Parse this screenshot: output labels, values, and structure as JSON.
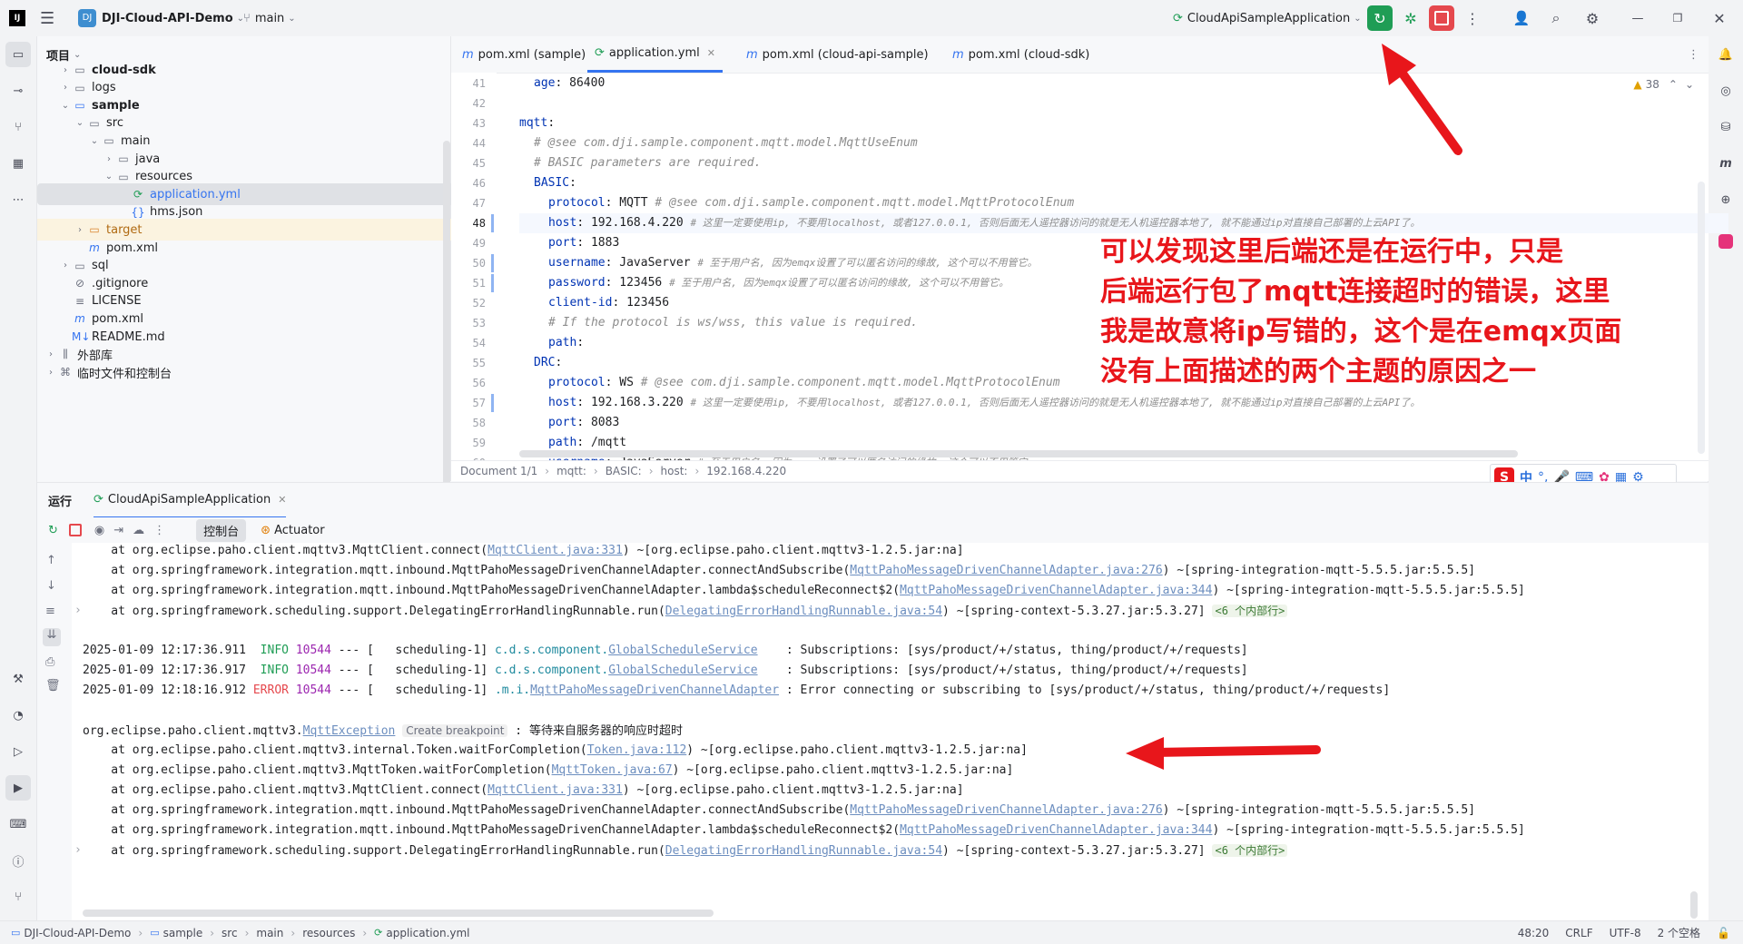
{
  "titlebar": {
    "logo": "IJ",
    "project_badge": "DJ",
    "project_name": "DJI-Cloud-API-Demo",
    "branch": "main",
    "run_config": "CloudApiSampleApplication"
  },
  "project_panel": {
    "title": "项目",
    "items": [
      {
        "label": "cloud-sdk",
        "indent": 1,
        "type": "folder",
        "arrow": ">",
        "bold": true
      },
      {
        "label": "logs",
        "indent": 1,
        "type": "folder",
        "arrow": ">",
        "bold": false
      },
      {
        "label": "sample",
        "indent": 1,
        "type": "module",
        "arrow": "v",
        "bold": true
      },
      {
        "label": "src",
        "indent": 2,
        "type": "folder",
        "arrow": "v",
        "bold": false
      },
      {
        "label": "main",
        "indent": 3,
        "type": "folder",
        "arrow": "v",
        "bold": false
      },
      {
        "label": "java",
        "indent": 4,
        "type": "folder",
        "arrow": ">",
        "bold": false
      },
      {
        "label": "resources",
        "indent": 4,
        "type": "folder",
        "arrow": "v",
        "bold": false
      },
      {
        "label": "application.yml",
        "indent": 5,
        "type": "yml",
        "arrow": "",
        "bold": false,
        "selected": true
      },
      {
        "label": "hms.json",
        "indent": 5,
        "type": "json",
        "arrow": "",
        "bold": false
      },
      {
        "label": "target",
        "indent": 2,
        "type": "folder-orange",
        "arrow": ">",
        "bold": false,
        "highlight": true
      },
      {
        "label": "pom.xml",
        "indent": 2,
        "type": "maven",
        "arrow": "",
        "bold": false
      },
      {
        "label": "sql",
        "indent": 1,
        "type": "folder",
        "arrow": ">",
        "bold": false
      },
      {
        "label": ".gitignore",
        "indent": 1,
        "type": "ignore",
        "arrow": "",
        "bold": false
      },
      {
        "label": "LICENSE",
        "indent": 1,
        "type": "text",
        "arrow": "",
        "bold": false
      },
      {
        "label": "pom.xml",
        "indent": 1,
        "type": "maven",
        "arrow": "",
        "bold": false
      },
      {
        "label": "README.md",
        "indent": 1,
        "type": "md",
        "arrow": "",
        "bold": false
      },
      {
        "label": "外部库",
        "indent": 0,
        "type": "lib",
        "arrow": ">",
        "bold": false
      },
      {
        "label": "临时文件和控制台",
        "indent": 0,
        "type": "scratch",
        "arrow": ">",
        "bold": false
      }
    ]
  },
  "tabs": [
    {
      "label": "pom.xml (sample)",
      "icon": "maven",
      "active": false
    },
    {
      "label": "application.yml",
      "icon": "yml",
      "active": true
    },
    {
      "label": "pom.xml (cloud-api-sample)",
      "icon": "maven",
      "active": false
    },
    {
      "label": "pom.xml (cloud-sdk)",
      "icon": "maven",
      "active": false
    }
  ],
  "editor": {
    "warnings": "38",
    "lines": [
      {
        "n": "41",
        "indent": 1,
        "parts": [
          {
            "t": "k",
            "s": "age"
          },
          {
            "t": "v",
            "s": ": 86400"
          }
        ]
      },
      {
        "n": "42",
        "indent": 0,
        "parts": []
      },
      {
        "n": "43",
        "indent": 0,
        "parts": [
          {
            "t": "k",
            "s": "mqtt"
          },
          {
            "t": "v",
            "s": ":"
          }
        ]
      },
      {
        "n": "44",
        "indent": 1,
        "parts": [
          {
            "t": "c",
            "s": "# @see com.dji.sample.component.mqtt.model.MqttUseEnum"
          }
        ]
      },
      {
        "n": "45",
        "indent": 1,
        "parts": [
          {
            "t": "c",
            "s": "# BASIC parameters are required."
          }
        ]
      },
      {
        "n": "46",
        "indent": 1,
        "parts": [
          {
            "t": "k",
            "s": "BASIC"
          },
          {
            "t": "v",
            "s": ":"
          }
        ]
      },
      {
        "n": "47",
        "indent": 2,
        "parts": [
          {
            "t": "k",
            "s": "protocol"
          },
          {
            "t": "v",
            "s": ": MQTT "
          },
          {
            "t": "c",
            "s": "# @see com.dji.sample.component.mqtt.model.MqttProtocolEnum"
          }
        ]
      },
      {
        "n": "48",
        "indent": 2,
        "parts": [
          {
            "t": "k",
            "s": "host"
          },
          {
            "t": "v",
            "s": ": 192.168.4.220 "
          },
          {
            "t": "c",
            "s": "# 这里一定要使用ip, 不要用localhost, 或者127.0.0.1, 否则后面无人遥控器访问的就是无人机遥控器本地了, 就不能通过ip对直接自己部署的上云API了。"
          }
        ]
      },
      {
        "n": "49",
        "indent": 2,
        "parts": [
          {
            "t": "k",
            "s": "port"
          },
          {
            "t": "v",
            "s": ": 1883"
          }
        ]
      },
      {
        "n": "50",
        "indent": 2,
        "parts": [
          {
            "t": "k",
            "s": "username"
          },
          {
            "t": "v",
            "s": ": JavaServer "
          },
          {
            "t": "c",
            "s": "# 至于用户名, 因为emqx设置了可以匿名访问的缘故, 这个可以不用管它。"
          }
        ]
      },
      {
        "n": "51",
        "indent": 2,
        "parts": [
          {
            "t": "k",
            "s": "password"
          },
          {
            "t": "v",
            "s": ": 123456 "
          },
          {
            "t": "c",
            "s": "# 至于用户名, 因为emqx设置了可以匿名访问的缘故, 这个可以不用管它。"
          }
        ]
      },
      {
        "n": "52",
        "indent": 2,
        "parts": [
          {
            "t": "k",
            "s": "client-id"
          },
          {
            "t": "v",
            "s": ": 123456"
          }
        ]
      },
      {
        "n": "53",
        "indent": 2,
        "parts": [
          {
            "t": "c",
            "s": "# If the protocol is ws/wss, this value is required."
          }
        ]
      },
      {
        "n": "54",
        "indent": 2,
        "parts": [
          {
            "t": "k",
            "s": "path"
          },
          {
            "t": "v",
            "s": ":"
          }
        ]
      },
      {
        "n": "55",
        "indent": 1,
        "parts": [
          {
            "t": "k",
            "s": "DRC"
          },
          {
            "t": "v",
            "s": ":"
          }
        ]
      },
      {
        "n": "56",
        "indent": 2,
        "parts": [
          {
            "t": "k",
            "s": "protocol"
          },
          {
            "t": "v",
            "s": ": WS "
          },
          {
            "t": "c",
            "s": "# @see com.dji.sample.component.mqtt.model.MqttProtocolEnum"
          }
        ]
      },
      {
        "n": "57",
        "indent": 2,
        "parts": [
          {
            "t": "k",
            "s": "host"
          },
          {
            "t": "v",
            "s": ": 192.168.3.220 "
          },
          {
            "t": "c",
            "s": "# 这里一定要使用ip, 不要用localhost, 或者127.0.0.1, 否则后面无人遥控器访问的就是无人机遥控器本地了, 就不能通过ip对直接自己部署的上云API了。"
          }
        ]
      },
      {
        "n": "58",
        "indent": 2,
        "parts": [
          {
            "t": "k",
            "s": "port"
          },
          {
            "t": "v",
            "s": ": 8083"
          }
        ]
      },
      {
        "n": "59",
        "indent": 2,
        "parts": [
          {
            "t": "k",
            "s": "path"
          },
          {
            "t": "v",
            "s": ": /mqtt"
          }
        ]
      },
      {
        "n": "60",
        "indent": 2,
        "parts": [
          {
            "t": "k",
            "s": "username"
          },
          {
            "t": "v",
            "s": ": JavaServer "
          },
          {
            "t": "c",
            "s": "# 至于用户名, 因为emqx设置了可以匿名访问的缘故, 这个可以不用管它。"
          }
        ]
      }
    ],
    "breadcrumb": [
      "Document 1/1",
      "mqtt:",
      "BASIC:",
      "host:",
      "192.168.4.220"
    ]
  },
  "annotation": {
    "lines": [
      "可以发现这里后端还是在运行中，只是",
      "后端运行包了mqtt连接超时的错误，这里",
      "我是故意将ip写错的，这个是在emqx页面",
      "没有上面描述的两个主题的原因之一"
    ]
  },
  "ime": {
    "logo": "S",
    "lang": "中"
  },
  "run_panel": {
    "title": "运行",
    "tab": "CloudApiSampleApplication",
    "subtab_console": "控制台",
    "subtab_actuator": "Actuator"
  },
  "console": {
    "lines": [
      {
        "parts": [
          {
            "t": "p",
            "s": "    at org.eclipse.paho.client.mqttv3.MqttClient.connect("
          },
          {
            "t": "l",
            "s": "MqttClient.java:331"
          },
          {
            "t": "p",
            "s": ") ~[org.eclipse.paho.client.mqttv3-1.2.5.jar:na]"
          }
        ]
      },
      {
        "parts": [
          {
            "t": "p",
            "s": "    at org.springframework.integration.mqtt.inbound.MqttPahoMessageDrivenChannelAdapter.connectAndSubscribe("
          },
          {
            "t": "l",
            "s": "MqttPahoMessageDrivenChannelAdapter.java:276"
          },
          {
            "t": "p",
            "s": ") ~[spring-integration-mqtt-5.5.5.jar:5.5.5]"
          }
        ]
      },
      {
        "parts": [
          {
            "t": "p",
            "s": "    at org.springframework.integration.mqtt.inbound.MqttPahoMessageDrivenChannelAdapter.lambda$scheduleReconnect$2("
          },
          {
            "t": "l",
            "s": "MqttPahoMessageDrivenChannelAdapter.java:344"
          },
          {
            "t": "p",
            "s": ") ~[spring-integration-mqtt-5.5.5.jar:5.5.5]"
          }
        ]
      },
      {
        "parts": [
          {
            "t": "p",
            "s": "    at org.springframework.scheduling.support.DelegatingErrorHandlingRunnable.run("
          },
          {
            "t": "l",
            "s": "DelegatingErrorHandlingRunnable.java:54"
          },
          {
            "t": "p",
            "s": ") ~[spring-context-5.3.27.jar:5.3.27] "
          },
          {
            "t": "h",
            "s": "<6 个内部行>"
          }
        ]
      },
      {
        "parts": []
      },
      {
        "parts": [
          {
            "t": "p",
            "s": "2025-01-09 12:17:36.911  "
          },
          {
            "t": "info",
            "s": "INFO"
          },
          {
            "t": "p",
            "s": " "
          },
          {
            "t": "pid",
            "s": "10544"
          },
          {
            "t": "p",
            "s": " --- [   scheduling-1] "
          },
          {
            "t": "cls",
            "s": "c.d.s.component."
          },
          {
            "t": "l",
            "s": "GlobalScheduleService"
          },
          {
            "t": "p",
            "s": "    : Subscriptions: [sys/product/+/status, thing/product/+/requests]"
          }
        ]
      },
      {
        "parts": [
          {
            "t": "p",
            "s": "2025-01-09 12:17:36.917  "
          },
          {
            "t": "info",
            "s": "INFO"
          },
          {
            "t": "p",
            "s": " "
          },
          {
            "t": "pid",
            "s": "10544"
          },
          {
            "t": "p",
            "s": " --- [   scheduling-1] "
          },
          {
            "t": "cls",
            "s": "c.d.s.component."
          },
          {
            "t": "l",
            "s": "GlobalScheduleService"
          },
          {
            "t": "p",
            "s": "    : Subscriptions: [sys/product/+/status, thing/product/+/requests]"
          }
        ]
      },
      {
        "parts": [
          {
            "t": "p",
            "s": "2025-01-09 12:18:16.912 "
          },
          {
            "t": "err",
            "s": "ERROR"
          },
          {
            "t": "p",
            "s": " "
          },
          {
            "t": "pid",
            "s": "10544"
          },
          {
            "t": "p",
            "s": " --- [   scheduling-1] "
          },
          {
            "t": "cls",
            "s": ".m.i."
          },
          {
            "t": "l",
            "s": "MqttPahoMessageDrivenChannelAdapter"
          },
          {
            "t": "p",
            "s": " : Error connecting or subscribing to [sys/product/+/status, thing/product/+/requests]"
          }
        ]
      },
      {
        "parts": []
      },
      {
        "parts": [
          {
            "t": "p",
            "s": "org.eclipse.paho.client.mqttv3."
          },
          {
            "t": "l",
            "s": "MqttException"
          },
          {
            "t": "p",
            "s": " "
          },
          {
            "t": "bp",
            "s": "Create breakpoint"
          },
          {
            "t": "p",
            "s": " : 等待来自服务器的响应时超时"
          }
        ]
      },
      {
        "parts": [
          {
            "t": "p",
            "s": "    at org.eclipse.paho.client.mqttv3.internal.Token.waitForCompletion("
          },
          {
            "t": "l",
            "s": "Token.java:112"
          },
          {
            "t": "p",
            "s": ") ~[org.eclipse.paho.client.mqttv3-1.2.5.jar:na]"
          }
        ]
      },
      {
        "parts": [
          {
            "t": "p",
            "s": "    at org.eclipse.paho.client.mqttv3.MqttToken.waitForCompletion("
          },
          {
            "t": "l",
            "s": "MqttToken.java:67"
          },
          {
            "t": "p",
            "s": ") ~[org.eclipse.paho.client.mqttv3-1.2.5.jar:na]"
          }
        ]
      },
      {
        "parts": [
          {
            "t": "p",
            "s": "    at org.eclipse.paho.client.mqttv3.MqttClient.connect("
          },
          {
            "t": "l",
            "s": "MqttClient.java:331"
          },
          {
            "t": "p",
            "s": ") ~[org.eclipse.paho.client.mqttv3-1.2.5.jar:na]"
          }
        ]
      },
      {
        "parts": [
          {
            "t": "p",
            "s": "    at org.springframework.integration.mqtt.inbound.MqttPahoMessageDrivenChannelAdapter.connectAndSubscribe("
          },
          {
            "t": "l",
            "s": "MqttPahoMessageDrivenChannelAdapter.java:276"
          },
          {
            "t": "p",
            "s": ") ~[spring-integration-mqtt-5.5.5.jar:5.5.5]"
          }
        ]
      },
      {
        "parts": [
          {
            "t": "p",
            "s": "    at org.springframework.integration.mqtt.inbound.MqttPahoMessageDrivenChannelAdapter.lambda$scheduleReconnect$2("
          },
          {
            "t": "l",
            "s": "MqttPahoMessageDrivenChannelAdapter.java:344"
          },
          {
            "t": "p",
            "s": ") ~[spring-integration-mqtt-5.5.5.jar:5.5.5]"
          }
        ]
      },
      {
        "parts": [
          {
            "t": "p",
            "s": "    at org.springframework.scheduling.support.DelegatingErrorHandlingRunnable.run("
          },
          {
            "t": "l",
            "s": "DelegatingErrorHandlingRunnable.java:54"
          },
          {
            "t": "p",
            "s": ") ~[spring-context-5.3.27.jar:5.3.27] "
          },
          {
            "t": "h",
            "s": "<6 个内部行>"
          }
        ]
      }
    ]
  },
  "statusbar": {
    "crumbs": [
      "DJI-Cloud-API-Demo",
      "sample",
      "src",
      "main",
      "resources",
      "application.yml"
    ],
    "position": "48:20",
    "line_sep": "CRLF",
    "encoding": "UTF-8",
    "indent": "2 个空格"
  },
  "colors": {
    "accent": "#3574f0",
    "run_green": "#1f9d55",
    "stop_red": "#e5484d",
    "arrow_red": "#e8161b"
  }
}
